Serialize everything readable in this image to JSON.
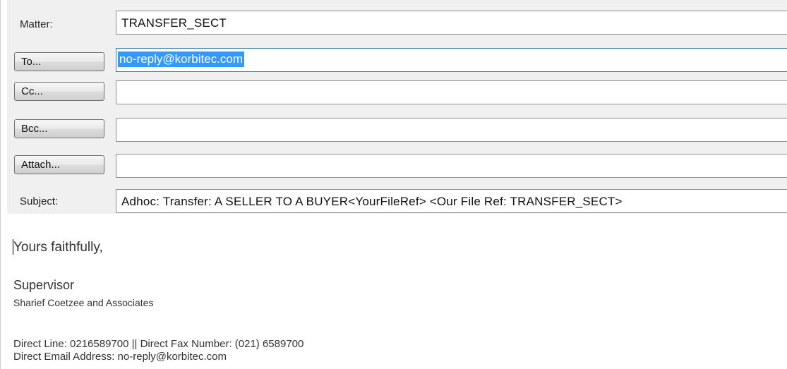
{
  "header": {
    "matter_label": "Matter:",
    "matter_value": "TRANSFER_SECT",
    "to_button": "To...",
    "to_value": "no-reply@korbitec.com",
    "cc_button": "Cc...",
    "cc_value": "",
    "bcc_button": "Bcc...",
    "bcc_value": "",
    "attach_button": "Attach...",
    "attach_value": "",
    "subject_label": "Subject:",
    "subject_value": "Adhoc: Transfer: A SELLER TO A BUYER<YourFileRef> <Our File Ref: TRANSFER_SECT>"
  },
  "body": {
    "closing": "Yours faithfully,",
    "signature_title": "Supervisor",
    "signature_firm": "Sharief Coetzee and Associates",
    "contact_line1": "Direct Line:  0216589700 || Direct Fax Number:  (021) 6589700",
    "contact_line2": "Direct Email Address:  no-reply@korbitec.com"
  },
  "colors": {
    "header_bg": "#f0f0f0",
    "selection": "#3399ff",
    "field_border": "#8e8f8f"
  }
}
